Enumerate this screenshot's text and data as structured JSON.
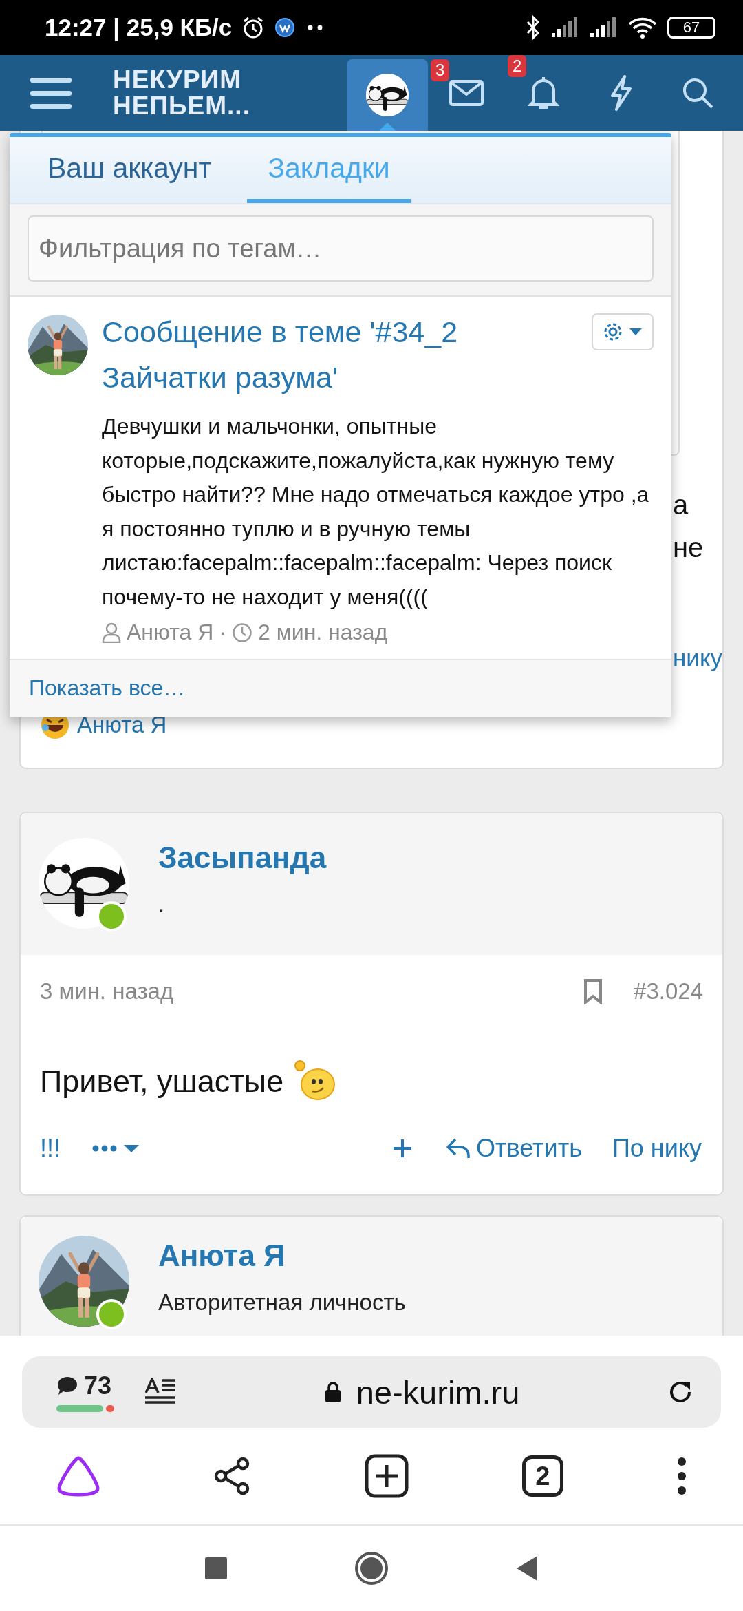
{
  "status_bar": {
    "time": "12:27 | 25,9 КБ/с",
    "battery": "67"
  },
  "header": {
    "logo_lines": [
      "НЕКУРИМ",
      "НЕПЬЕМ..."
    ],
    "messages_badge": "3",
    "alerts_badge": "2"
  },
  "background_post": {
    "fragments": [
      "а",
      "не"
    ],
    "link_fragment": "нику",
    "reaction_user": "Анюта Я"
  },
  "dropdown": {
    "tabs": [
      {
        "label": "Ваш аккаунт",
        "selected": false
      },
      {
        "label": "Закладки",
        "selected": true
      }
    ],
    "filter": {
      "placeholder": "Фильтрация по тегам…"
    },
    "bookmarks": [
      {
        "title": "Сообщение в теме '#34_2 Зайчатки разума'",
        "body": "Девчушки и мальчонки, опытные которые,подскажите,пожалуйста,как нужную тему быстро найти?? Мне надо отмечаться каждое утро ,а я постоянно туплю и в ручную темы листаю:facepalm::facepalm::facepalm: Через поиск почему-то не находит у меня((((",
        "author": "Анюта Я",
        "separator": "·",
        "time": "2 мин. назад"
      }
    ],
    "footer_link": "Показать все…"
  },
  "posts": [
    {
      "author": "Засыпанда",
      "user_title": ".",
      "online": true,
      "time": "3 мин. назад",
      "number": "#3.024",
      "body": "Привет, ушастые",
      "actions": {
        "left": "!!!",
        "reply": "Ответить",
        "by_nick": "По нику"
      }
    },
    {
      "author": "Анюта Я",
      "user_title": "Авторитетная личность",
      "online": true
    }
  ],
  "browser": {
    "comments": "73",
    "url": "ne-kurim.ru",
    "tabs_count": "2"
  }
}
